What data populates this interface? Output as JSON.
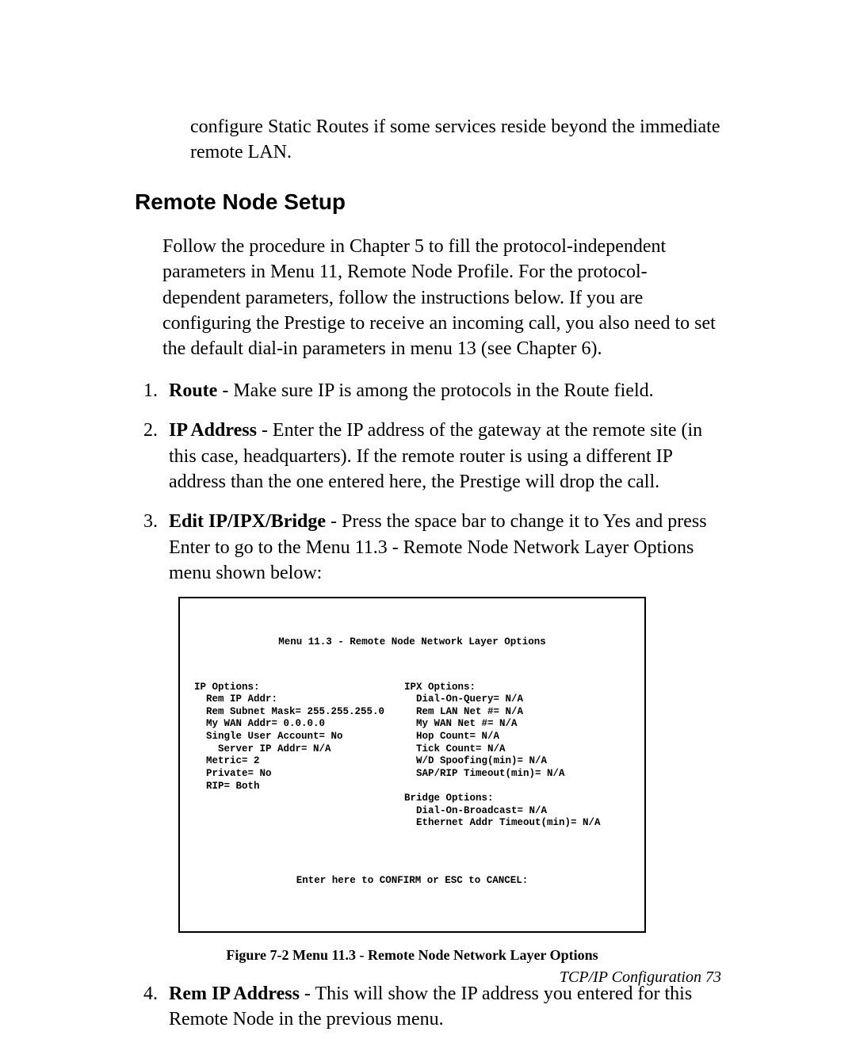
{
  "intro": "configure Static Routes if some services reside beyond the immediate remote LAN.",
  "section_title": "Remote Node Setup",
  "section_body": "Follow the procedure in Chapter 5 to fill the protocol-independent parameters in Menu 11, Remote Node Profile. For the protocol-dependent parameters, follow the instructions below. If you are configuring the Prestige to receive an incoming call, you also need to set the default dial-in parameters in menu 13 (see Chapter 6).",
  "list": [
    {
      "label": "Route",
      "text": " - Make sure IP is among the protocols in the Route field."
    },
    {
      "label": "IP Address",
      "text": " - Enter the IP address of the gateway at the remote site (in this case, headquarters). If the remote router is using a different IP address than the one entered here, the Prestige will drop the call."
    },
    {
      "label": "Edit IP/IPX/Bridge",
      "text": " - Press the space bar to change it to Yes and press Enter to go to the Menu 11.3 - Remote Node Network Layer Options menu shown below:"
    },
    {
      "label": "Rem IP Address",
      "text": " - This will show the IP address you entered for this Remote Node in the previous menu."
    }
  ],
  "terminal": {
    "title": "Menu 11.3 - Remote Node Network Layer Options",
    "left": "IP Options:\n  Rem IP Addr:\n  Rem Subnet Mask= 255.255.255.0\n  My WAN Addr= 0.0.0.0\n  Single User Account= No\n    Server IP Addr= N/A\n  Metric= 2\n  Private= No\n  RIP= Both",
    "right": "IPX Options:\n  Dial-On-Query= N/A\n  Rem LAN Net #= N/A\n  My WAN Net #= N/A\n  Hop Count= N/A\n  Tick Count= N/A\n  W/D Spoofing(min)= N/A\n  SAP/RIP Timeout(min)= N/A\n\nBridge Options:\n  Dial-On-Broadcast= N/A\n  Ethernet Addr Timeout(min)= N/A",
    "footer": "Enter here to CONFIRM or ESC to CANCEL:"
  },
  "figure_caption": "Figure 7-2 Menu 11.3 - Remote Node Network Layer Options",
  "page_footer": "TCP/IP Configuration  73"
}
